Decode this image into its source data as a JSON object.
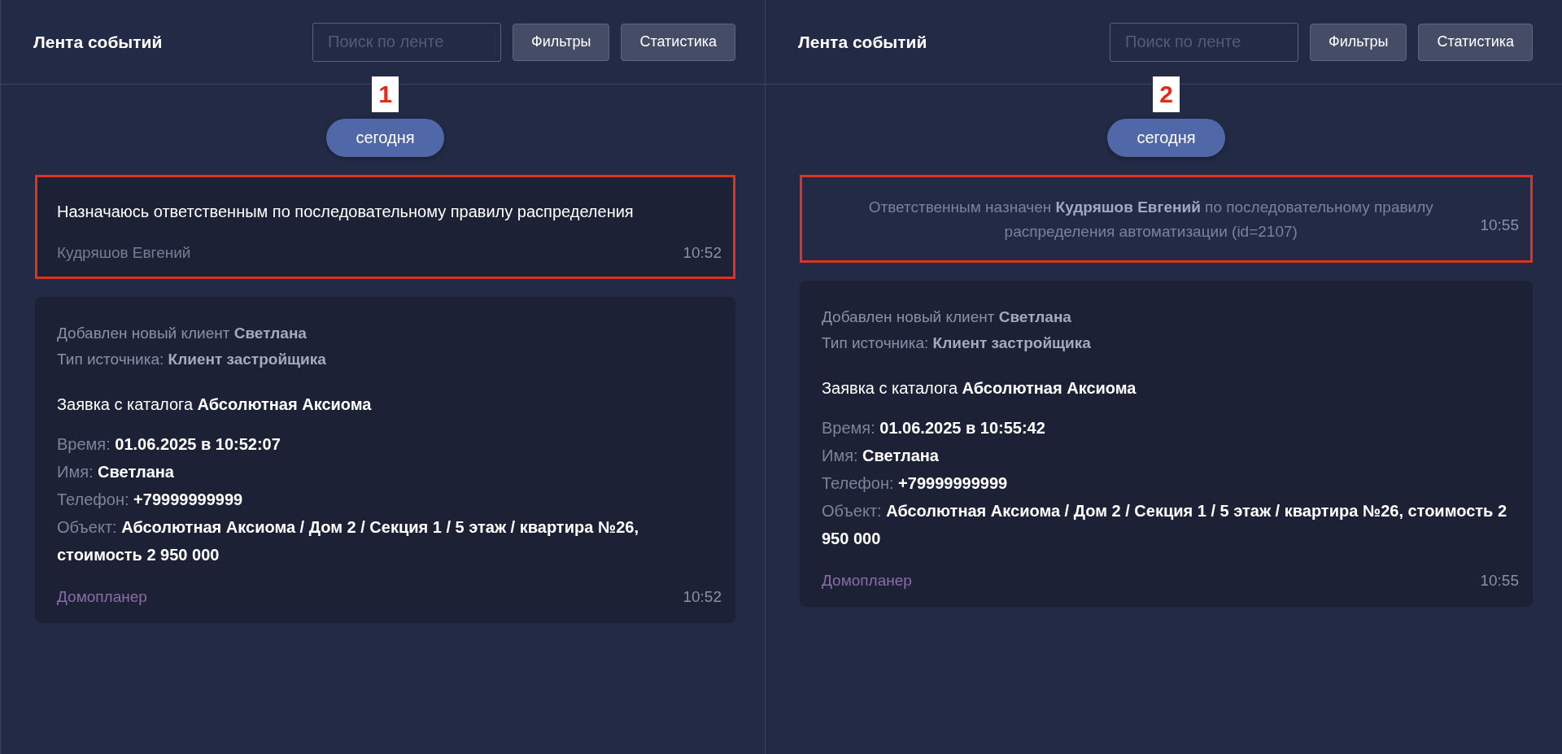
{
  "panels": [
    {
      "title": "Лента событий",
      "search": {
        "placeholder": "Поиск по ленте"
      },
      "buttons": [
        "Фильтры",
        "Статистика"
      ],
      "marker": "1",
      "date_label": "сегодня",
      "events": [
        {
          "kind": "note",
          "highlighted": true,
          "text": "Назначаюсь ответственным по последовательному правилу распределения",
          "author": "Кудряшов Евгений",
          "time": "10:52"
        },
        {
          "kind": "lead",
          "highlighted": false,
          "summary": [
            "Добавлен новый клиент **Светлана**",
            "Тип источника: **Клиент застройщика**"
          ],
          "heading": "Заявка с каталога **Абсолютная Аксиома**",
          "fields": [
            "Время: **01.06.2025 в 10:52:07**",
            "Имя: **Светлана**",
            "Телефон: **+79999999999**",
            "Объект: **Абсолютная Аксиома / Дом 2 / Секция 1 / 5 этаж / квартира №26, стоимость 2 950 000**"
          ],
          "source": "Домопланер",
          "time": "10:52"
        }
      ]
    },
    {
      "title": "Лента событий",
      "search": {
        "placeholder": "Поиск по ленте"
      },
      "buttons": [
        "Фильтры",
        "Статистика"
      ],
      "marker": "2",
      "date_label": "сегодня",
      "events": [
        {
          "kind": "system",
          "highlighted": true,
          "text": "Ответственным назначен **Кудряшов Евгений** по последовательному правилу распределения автоматизации (id=2107)",
          "time": "10:55"
        },
        {
          "kind": "lead",
          "highlighted": false,
          "summary": [
            "Добавлен новый клиент **Светлана**",
            "Тип источника: **Клиент застройщика**"
          ],
          "heading": "Заявка с каталога **Абсолютная Аксиома**",
          "fields": [
            "Время: **01.06.2025 в 10:55:42**",
            "Имя: **Светлана**",
            "Телефон: **+79999999999**",
            "Объект: **Абсолютная Аксиома / Дом 2 / Секция 1 / 5 этаж / квартира №26, стоимость 2 950 000**"
          ],
          "source": "Домопланер",
          "time": "10:55"
        }
      ]
    }
  ]
}
